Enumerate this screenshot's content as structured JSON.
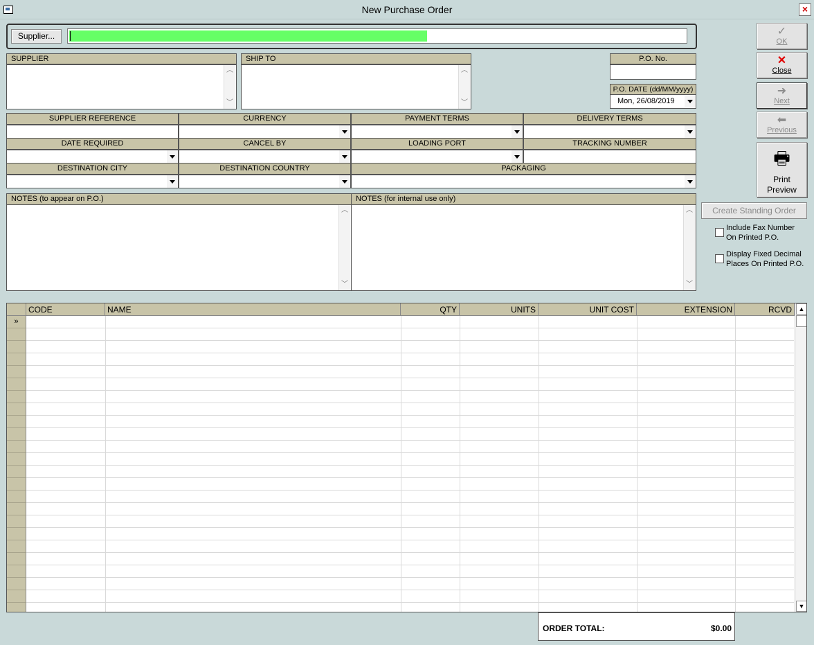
{
  "window": {
    "title": "New Purchase Order"
  },
  "supplier_row": {
    "button_label": "Supplier...",
    "progress_value": 0.58
  },
  "sections": {
    "supplier": "SUPPLIER",
    "ship_to": "SHIP TO"
  },
  "po": {
    "no_label": "P.O. No.",
    "no_value": "",
    "date_label": "P.O. DATE (dd/MM/yyyy)",
    "date_value": "Mon, 26/08/2019"
  },
  "fields": {
    "supplier_reference": "SUPPLIER REFERENCE",
    "currency": "CURRENCY",
    "payment_terms": "PAYMENT TERMS",
    "delivery_terms": "DELIVERY TERMS",
    "date_required": "DATE REQUIRED",
    "cancel_by": "CANCEL BY",
    "loading_port": "LOADING PORT",
    "tracking_number": "TRACKING NUMBER",
    "destination_city": "DESTINATION CITY",
    "destination_country": "DESTINATION COUNTRY",
    "packaging": "PACKAGING"
  },
  "notes": {
    "public_label": "NOTES (to appear on P.O.)",
    "internal_label": "NOTES (for internal use only)"
  },
  "side": {
    "ok": "OK",
    "close": "Close",
    "next": "Next",
    "previous": "Previous",
    "print_preview_line1": "Print",
    "print_preview_line2": "Preview",
    "create_standing_order": "Create Standing Order",
    "include_fax_line1": "Include Fax Number",
    "include_fax_line2": "On Printed P.O.",
    "fixed_decimal_line1": "Display Fixed Decimal",
    "fixed_decimal_line2": "Places On Printed P.O."
  },
  "grid": {
    "columns": [
      "CODE",
      "NAME",
      "QTY",
      "UNITS",
      "UNIT COST",
      "EXTENSION",
      "RCVD"
    ],
    "current_row_marker": "»"
  },
  "totals": {
    "label": "ORDER TOTAL:",
    "value": "$0.00"
  }
}
